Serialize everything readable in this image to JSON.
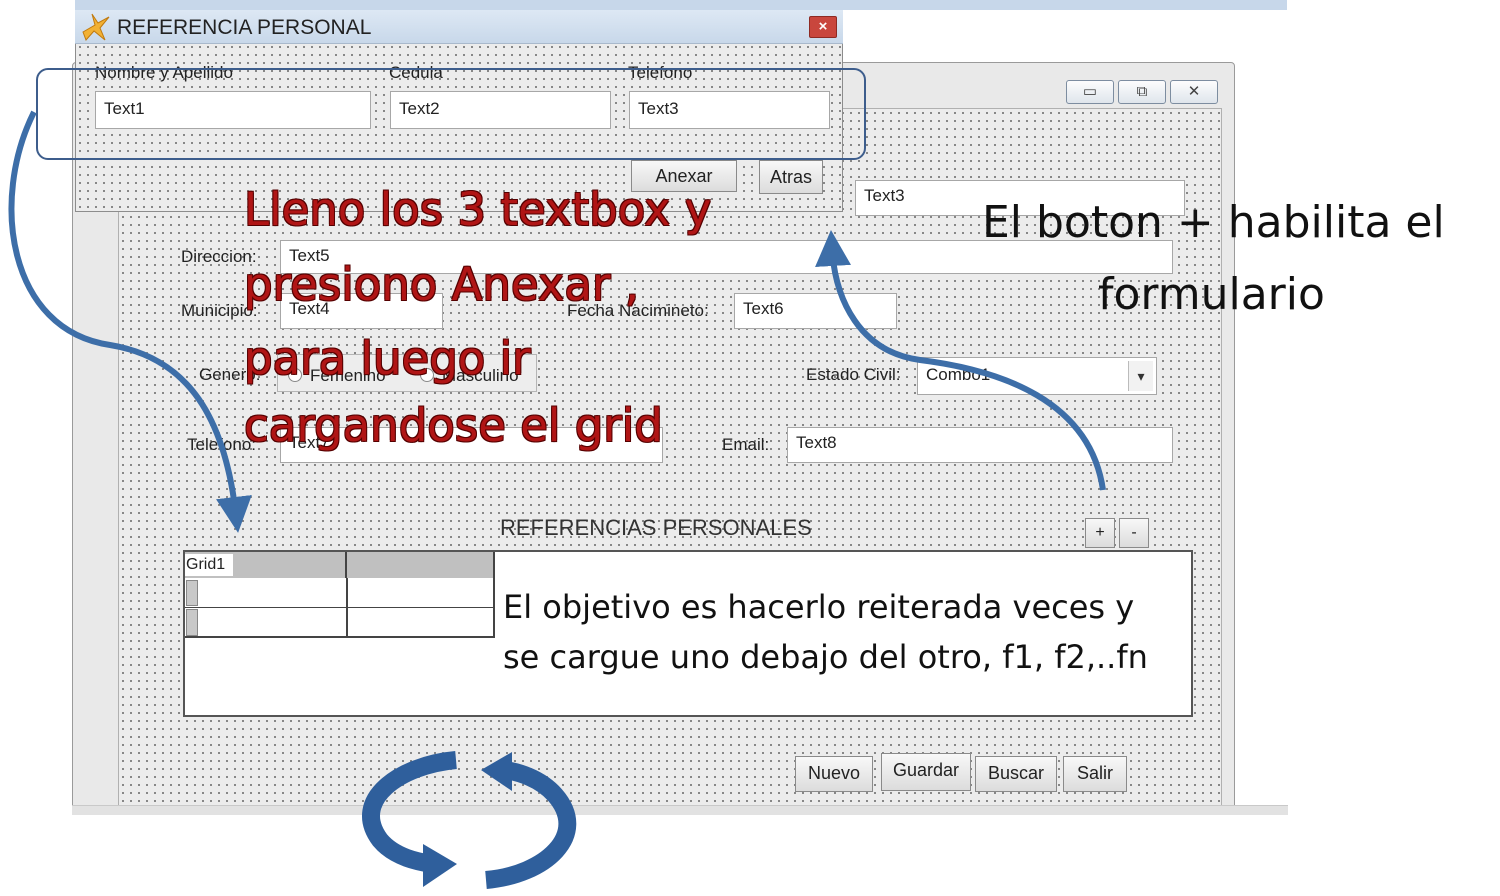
{
  "colors": {
    "accent_blue": "#3d6ea8",
    "annotation_red": "#b01515",
    "close_red": "#c9463d"
  },
  "dialog": {
    "title": "REFERENCIA PERSONAL",
    "close_label": "×",
    "icon": "app-bird-icon",
    "fields": [
      {
        "label": "Nombre y Apellido",
        "value": "Text1"
      },
      {
        "label": "Cedula",
        "value": "Text2"
      },
      {
        "label": "Telefono",
        "value": "Text3"
      }
    ],
    "buttons": {
      "anexar": "Anexar",
      "atras": "Atras"
    }
  },
  "main": {
    "window_buttons": {
      "minimize": "▭",
      "maximize": "⧉",
      "close": "✕"
    },
    "top_field_value": "Text3",
    "direccion": {
      "label": "Direccion:",
      "value": "Text5"
    },
    "municipio": {
      "label": "Municipio:",
      "value": "Text4"
    },
    "fecha": {
      "label": "Fecha Nacimineto:",
      "value": "Text6"
    },
    "genero": {
      "label": "Genero:",
      "options": [
        "Femenino",
        "Masculino"
      ]
    },
    "estado_civil": {
      "label": "Estado Civil:",
      "value": "Combo1"
    },
    "telefono": {
      "label": "Telefono:",
      "value": "Text7"
    },
    "email": {
      "label": "Email:",
      "value": "Text8"
    },
    "section_title": "REFERENCIAS PERSONALES",
    "plus_label": "+",
    "minus_label": "-",
    "grid_caption": "Grid1",
    "buttons": {
      "nuevo": "Nuevo",
      "guardar": "Guardar",
      "buscar": "Buscar",
      "salir": "Salir"
    }
  },
  "annotations": {
    "red_lines": [
      "Lleno los 3 textbox y",
      "presiono Anexar ,",
      "para luego ir",
      "cargandose el grid"
    ],
    "plus_note_line1": "El boton + habilita el",
    "plus_note_line2": "formulario",
    "objective_line1": "El objetivo es hacerlo reiterada veces y",
    "objective_line2": "se cargue uno debajo del otro, f1, f2,..fn"
  }
}
